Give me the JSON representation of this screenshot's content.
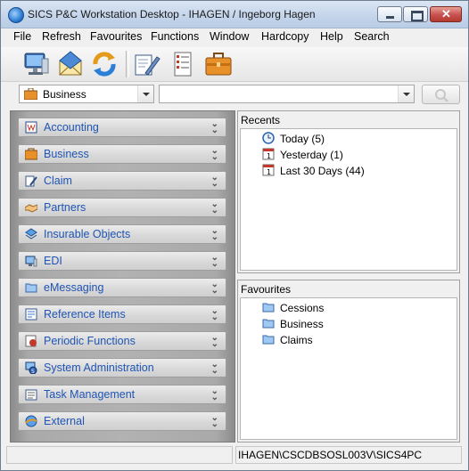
{
  "window": {
    "title": "SICS P&C Workstation Desktop - IHAGEN / Ingeborg Hagen"
  },
  "menu": [
    "File",
    "Refresh",
    "Favourites",
    "Functions",
    "Window",
    "Hardcopy",
    "Help",
    "Search"
  ],
  "toolbar": {
    "icons": [
      "desktop-icon",
      "mail-icon",
      "refresh-icon",
      "edit-document-icon",
      "list-icon",
      "briefcase-icon"
    ]
  },
  "address": {
    "context_value": "Business",
    "search_value": ""
  },
  "nav": [
    {
      "label": "Accounting",
      "icon": "accounting-icon"
    },
    {
      "label": "Business",
      "icon": "briefcase-icon"
    },
    {
      "label": "Claim",
      "icon": "claim-icon"
    },
    {
      "label": "Partners",
      "icon": "handshake-icon"
    },
    {
      "label": "Insurable Objects",
      "icon": "insurable-objects-icon"
    },
    {
      "label": "EDI",
      "icon": "edi-icon"
    },
    {
      "label": "eMessaging",
      "icon": "folder-icon"
    },
    {
      "label": "Reference Items",
      "icon": "reference-icon"
    },
    {
      "label": "Periodic Functions",
      "icon": "periodic-icon"
    },
    {
      "label": "System Administration",
      "icon": "admin-icon"
    },
    {
      "label": "Task Management",
      "icon": "task-icon"
    },
    {
      "label": "External",
      "icon": "external-icon"
    }
  ],
  "recents": {
    "title": "Recents",
    "items": [
      {
        "label": "Today (5)",
        "icon": "clock-icon"
      },
      {
        "label": "Yesterday (1)",
        "icon": "calendar-icon"
      },
      {
        "label": "Last 30 Days (44)",
        "icon": "calendar-icon"
      }
    ]
  },
  "favourites": {
    "title": "Favourites",
    "items": [
      {
        "label": "Cessions",
        "icon": "folder-icon"
      },
      {
        "label": "Business",
        "icon": "folder-icon"
      },
      {
        "label": "Claims",
        "icon": "folder-icon"
      }
    ]
  },
  "status": {
    "left": "",
    "right": "IHAGEN\\CSCDBSOSL003V\\SICS4PC"
  },
  "colors": {
    "nav_label": "#1f55b5",
    "panel_gray": "#b2b2b2",
    "title_bar": "#c3d4ea"
  }
}
